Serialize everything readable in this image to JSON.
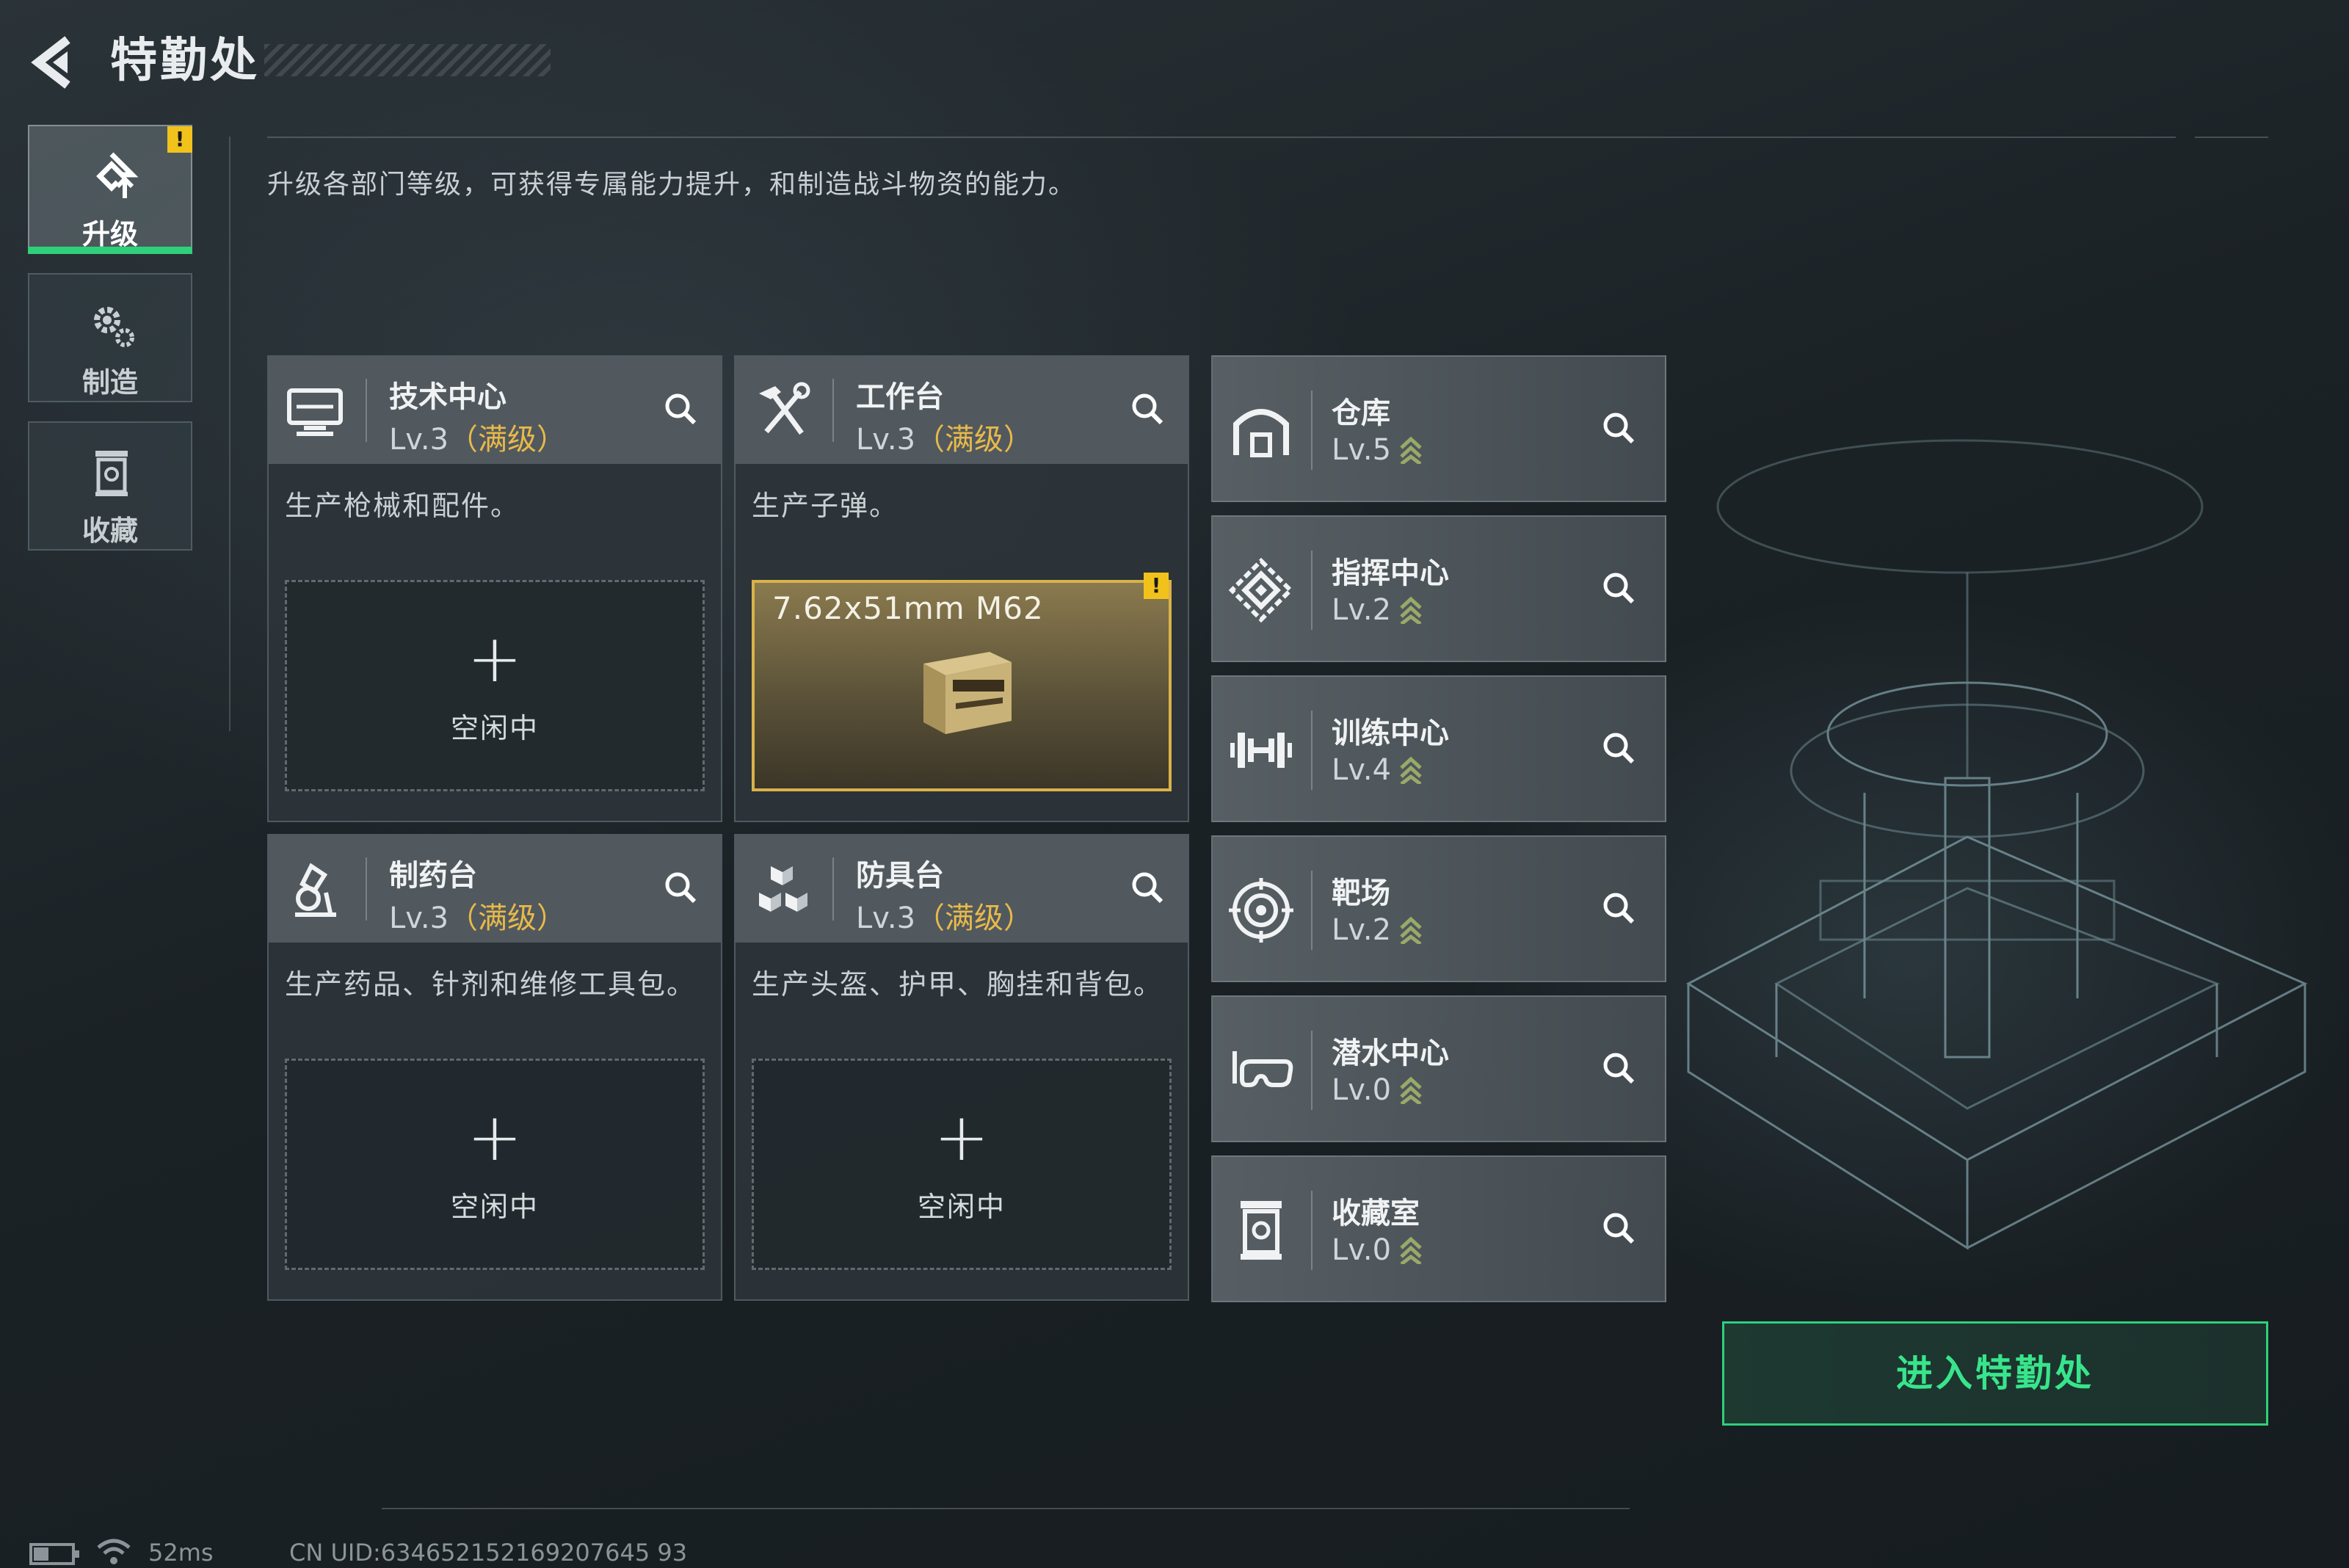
{
  "header": {
    "title": "特勤处"
  },
  "sidebar": {
    "tabs": [
      {
        "label": "升级",
        "icon": "upgrade-icon",
        "active": true,
        "badge": "!"
      },
      {
        "label": "制造",
        "icon": "gears-icon",
        "active": false
      },
      {
        "label": "收藏",
        "icon": "collection-icon",
        "active": false
      }
    ]
  },
  "intro": "升级各部门等级，可获得专属能力提升，和制造战斗物资的能力。",
  "cards": [
    {
      "name": "技术中心",
      "level": "Lv.3",
      "max": "（满级）",
      "desc": "生产枪械和配件。",
      "icon": "monitor-icon",
      "slot_label": "空闲中"
    },
    {
      "name": "工作台",
      "level": "Lv.3",
      "max": "（满级）",
      "desc": "生产子弹。",
      "icon": "hammer-wrench-icon",
      "slot_item": "7.62x51mm M62",
      "badge": "!"
    },
    {
      "name": "制药台",
      "level": "Lv.3",
      "max": "（满级）",
      "desc": "生产药品、针剂和维修工具包。",
      "icon": "microscope-icon",
      "slot_label": "空闲中"
    },
    {
      "name": "防具台",
      "level": "Lv.3",
      "max": "（满级）",
      "desc": "生产头盔、护甲、胸挂和背包。",
      "icon": "cubes-icon",
      "slot_label": "空闲中"
    }
  ],
  "facilities": [
    {
      "name": "仓库",
      "level": "Lv.5",
      "icon": "warehouse-icon"
    },
    {
      "name": "指挥中心",
      "level": "Lv.2",
      "icon": "command-icon"
    },
    {
      "name": "训练中心",
      "level": "Lv.4",
      "icon": "dumbbell-icon"
    },
    {
      "name": "靶场",
      "level": "Lv.2",
      "icon": "target-icon"
    },
    {
      "name": "潜水中心",
      "level": "Lv.0",
      "icon": "diving-mask-icon"
    },
    {
      "name": "收藏室",
      "level": "Lv.0",
      "icon": "collection-room-icon"
    }
  ],
  "enter_button": "进入特勤处",
  "status": {
    "ping": "52ms",
    "uid": "CN UID:634652152169207645 93"
  },
  "colors": {
    "accent_green": "#2fd07a",
    "max_level_gold": "#e8b94a",
    "warning_yellow": "#f2c21c"
  }
}
